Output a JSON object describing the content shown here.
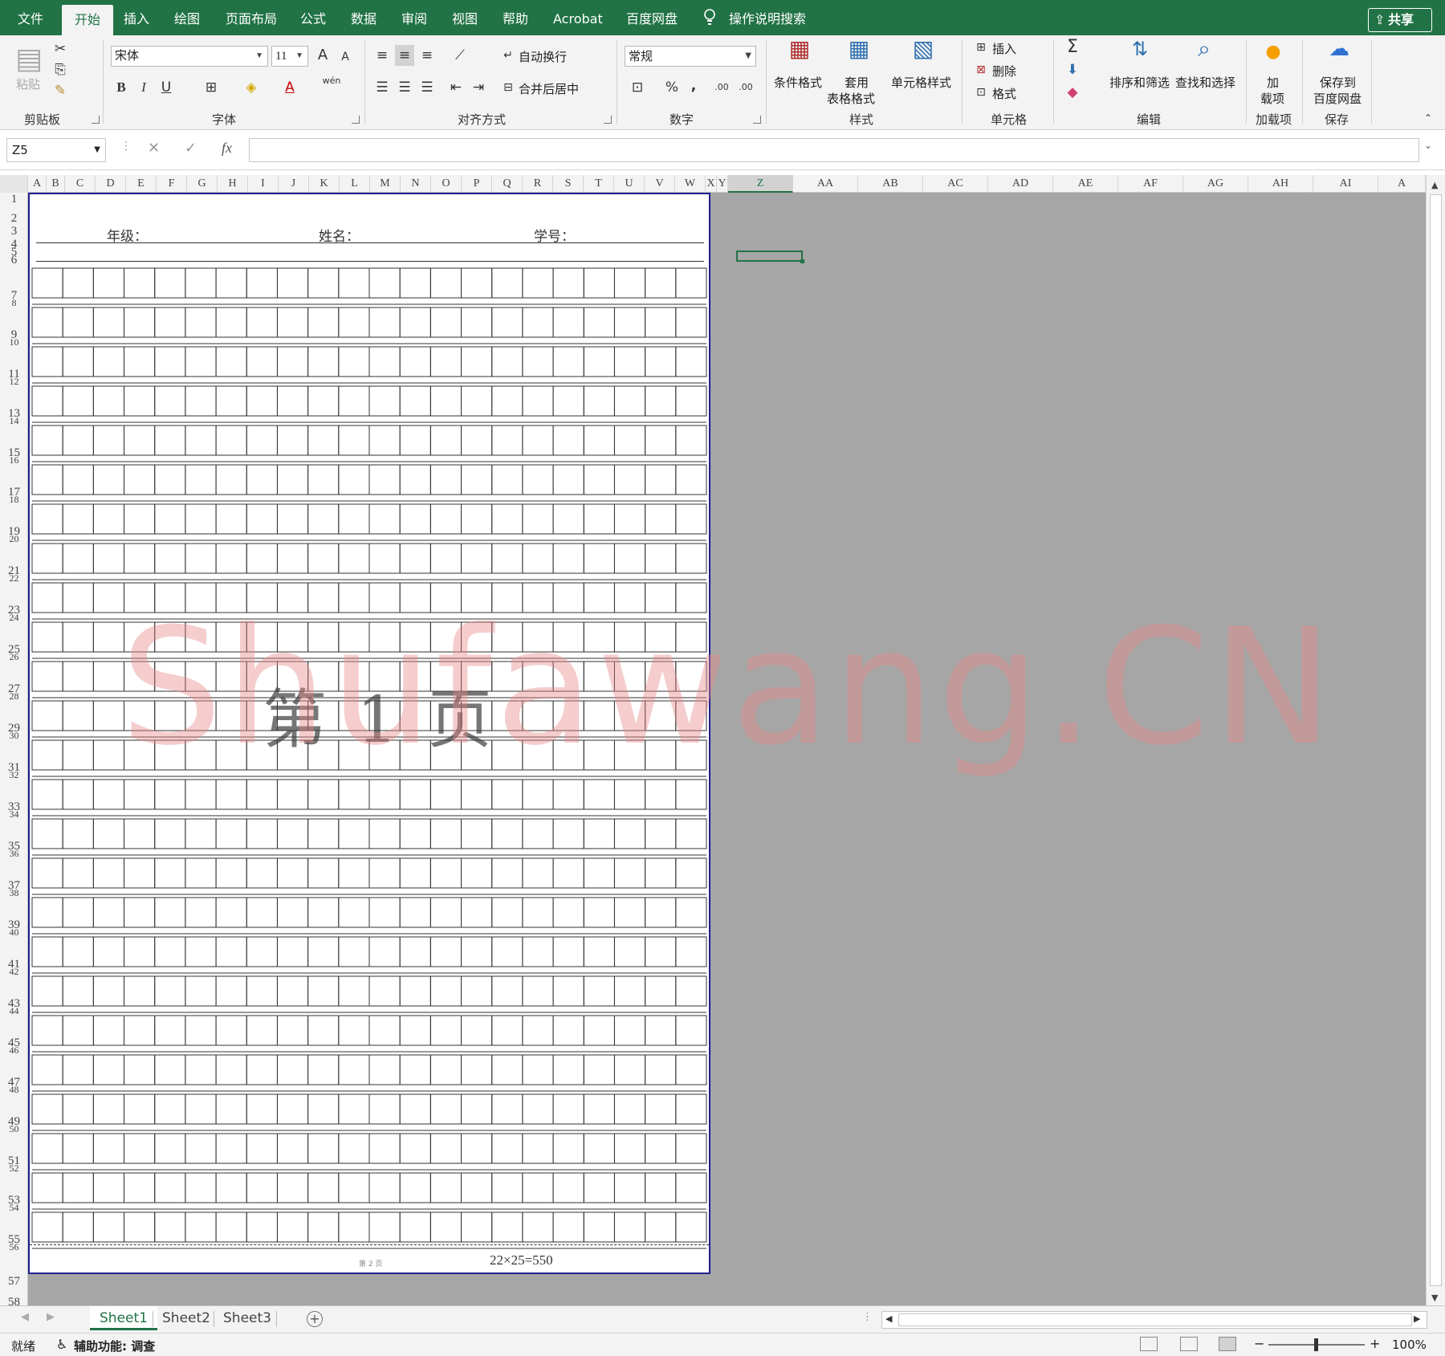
{
  "menu": {
    "tabs": [
      "文件",
      "开始",
      "插入",
      "绘图",
      "页面布局",
      "公式",
      "数据",
      "审阅",
      "视图",
      "帮助",
      "Acrobat",
      "百度网盘"
    ],
    "active_tab": "开始",
    "tell_me": "操作说明搜索",
    "share": "共享"
  },
  "ribbon": {
    "clipboard": {
      "paste": "粘贴",
      "group": "剪贴板"
    },
    "font": {
      "name": "宋体",
      "size": "11",
      "group": "字体",
      "bold": "B",
      "italic": "I",
      "underline": "U",
      "grow": "A",
      "shrink": "A",
      "phonetic": "wén"
    },
    "alignment": {
      "wrap": "自动换行",
      "merge": "合并后居中",
      "group": "对齐方式"
    },
    "number": {
      "format": "常规",
      "percent": "%",
      "comma": ",",
      "inc_decimal": ".00",
      "dec_decimal": ".00",
      "group": "数字"
    },
    "styles": {
      "conditional": "条件格式",
      "table_line1": "套用",
      "table_line2": "表格格式",
      "cell_styles": "单元格样式",
      "group": "样式"
    },
    "cells": {
      "insert": "插入",
      "delete": "删除",
      "format": "格式",
      "group": "单元格"
    },
    "editing": {
      "sort": "排序和筛选",
      "find": "查找和选择",
      "group": "编辑",
      "sigma": "Σ"
    },
    "addins": {
      "line1": "加",
      "line2": "载项",
      "group": "加载项"
    },
    "save": {
      "line1": "保存到",
      "line2": "百度网盘",
      "group": "保存"
    }
  },
  "formula_bar": {
    "name_box": "Z5",
    "fx": "fx",
    "value": ""
  },
  "columns": [
    "A",
    "B",
    "C",
    "D",
    "E",
    "F",
    "G",
    "H",
    "I",
    "J",
    "K",
    "L",
    "M",
    "N",
    "O",
    "P",
    "Q",
    "R",
    "S",
    "T",
    "U",
    "V",
    "W",
    "X",
    "Y",
    "Z",
    "AA",
    "AB",
    "AC",
    "AD",
    "AE",
    "AF",
    "AG",
    "AH",
    "AI",
    "A"
  ],
  "selected_column": "Z",
  "rows": [
    "1",
    "2",
    "3",
    "4",
    "5",
    "6",
    "7",
    "8",
    "9",
    "10",
    "11",
    "12",
    "13",
    "14",
    "15",
    "16",
    "17",
    "18",
    "19",
    "20",
    "21",
    "22",
    "23",
    "24",
    "25",
    "26",
    "27",
    "28",
    "29",
    "30",
    "31",
    "32",
    "33",
    "34",
    "35",
    "36",
    "37",
    "38",
    "39",
    "40",
    "41",
    "42",
    "43",
    "44",
    "45",
    "46",
    "47",
    "48",
    "49",
    "50",
    "51",
    "52",
    "53",
    "54",
    "55",
    "56",
    "57",
    "58"
  ],
  "sheet": {
    "grade_label": "年级：",
    "name_label": "姓名：",
    "student_id_label": "学号：",
    "page_watermark": "第 1 页",
    "footer_small": "第 2 页",
    "footer_text": "22×25=550",
    "grid_columns": 22,
    "grid_rows": 25
  },
  "site_watermark": "Shufawang.CN",
  "sheet_tabs": [
    "Sheet1",
    "Sheet2",
    "Sheet3"
  ],
  "active_sheet": "Sheet1",
  "status": {
    "ready": "就绪",
    "accessibility": "辅助功能: 调查",
    "zoom": "100%"
  },
  "colors": {
    "accent": "#217346",
    "page_border": "#1f1f8f",
    "gray_area": "#a6a6a6",
    "watermark": "#e88787"
  }
}
